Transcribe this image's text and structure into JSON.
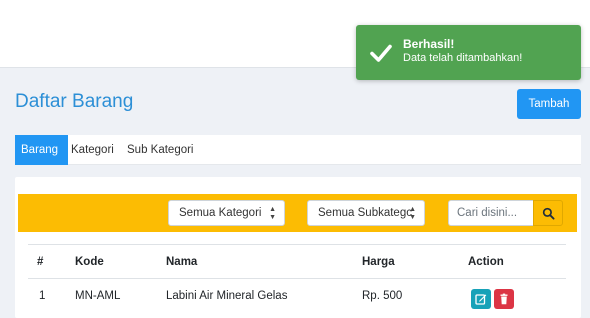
{
  "toast": {
    "title": "Berhasil!",
    "message": "Data telah ditambahkan!",
    "color": "#51a351"
  },
  "page": {
    "title": "Daftar Barang",
    "add_button": "Tambah"
  },
  "tabs": [
    {
      "label": "Barang",
      "active": true
    },
    {
      "label": "Kategori",
      "active": false
    },
    {
      "label": "Sub Kategori",
      "active": false
    }
  ],
  "filters": {
    "kategori": "Semua Kategori",
    "subkategori": "Semua Subkategc",
    "search_placeholder": "Cari disini...",
    "bar_color": "#fcbc03"
  },
  "table": {
    "headers": [
      "#",
      "Kode",
      "Nama",
      "Harga",
      "Action"
    ],
    "rows": [
      {
        "no": "1",
        "kode": "MN-AML",
        "nama": "Labini Air Mineral Gelas",
        "harga": "Rp. 500"
      }
    ]
  },
  "icons": {
    "toast": "check-icon",
    "search": "search-icon",
    "edit": "edit-icon",
    "delete": "trash-icon",
    "select": "sort-caret-icon"
  }
}
